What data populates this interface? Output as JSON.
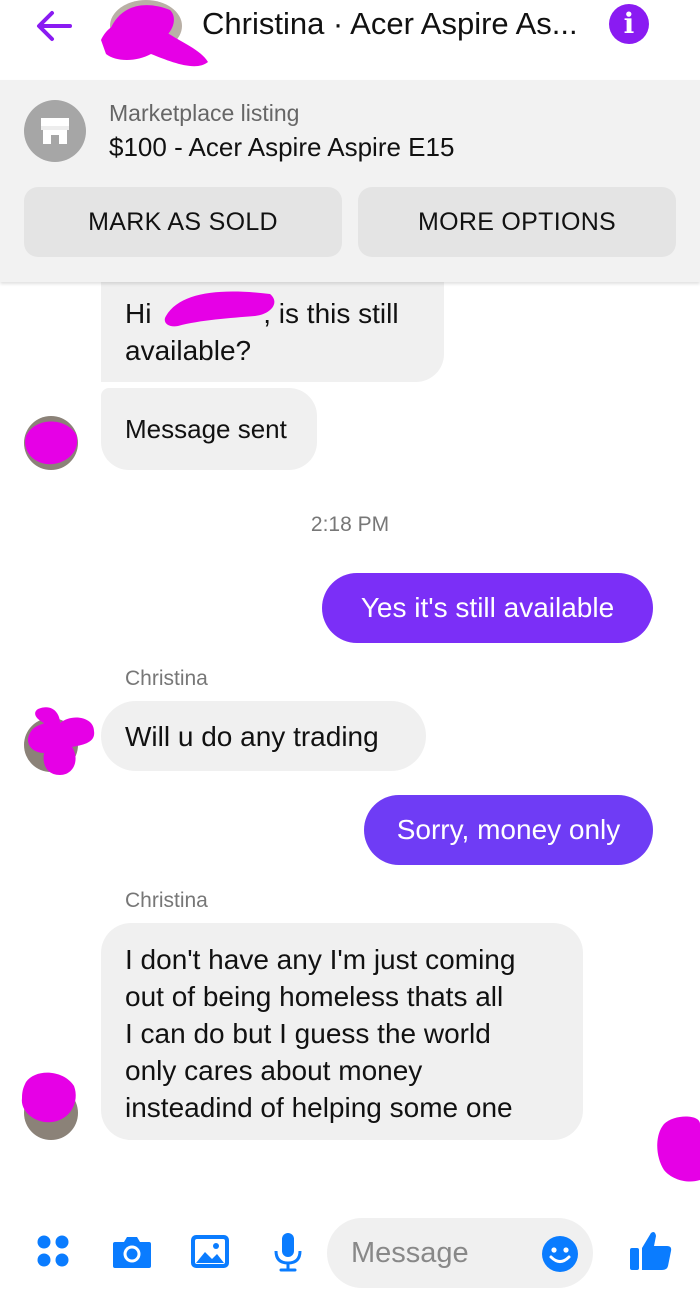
{
  "header": {
    "title": "Christina · Acer Aspire As...",
    "back_icon": "back-arrow-icon",
    "info_icon": "info-icon",
    "info_glyph": "i"
  },
  "listing": {
    "kicker": "Marketplace listing",
    "title": "$100 - Acer Aspire Aspire E15",
    "icon": "marketplace-store-icon",
    "mark_sold_label": "MARK AS SOLD",
    "more_options_label": "MORE OPTIONS"
  },
  "messages": {
    "m1_line1_prefix": "Hi",
    "m1_line1_suffix": ", is this still",
    "m1_line2": "available?",
    "m2": "Message sent",
    "time": "2:18 PM",
    "m3": "Yes it's still available",
    "sender1": "Christina",
    "m4": "Will u do any trading",
    "m5": "Sorry, money only",
    "sender2": "Christina",
    "m6_lines": [
      "I don't have any I'm just coming",
      "out of being homeless thats all",
      "I can do but I guess the world",
      "only cares about money",
      "insteadind of helping some one"
    ]
  },
  "composer": {
    "placeholder": "Message",
    "icons": [
      "apps-icon",
      "camera-icon",
      "gallery-icon",
      "microphone-icon",
      "emoji-icon",
      "thumbs-up-icon"
    ]
  },
  "colors": {
    "accent": "#8a1bf2",
    "outgoing_bubble": "#7b2ff7",
    "incoming_bubble": "#f0f0f0",
    "toolbar_blue": "#0a7cff",
    "redaction": "#e600e6"
  }
}
